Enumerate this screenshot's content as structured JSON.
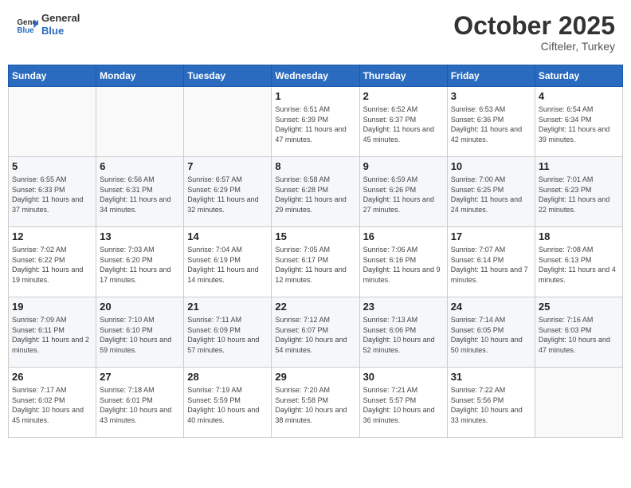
{
  "header": {
    "logo_line1": "General",
    "logo_line2": "Blue",
    "month": "October 2025",
    "location": "Cifteler, Turkey"
  },
  "weekdays": [
    "Sunday",
    "Monday",
    "Tuesday",
    "Wednesday",
    "Thursday",
    "Friday",
    "Saturday"
  ],
  "weeks": [
    [
      {
        "day": null
      },
      {
        "day": null
      },
      {
        "day": null
      },
      {
        "day": 1,
        "sunrise": "6:51 AM",
        "sunset": "6:39 PM",
        "daylight": "11 hours and 47 minutes."
      },
      {
        "day": 2,
        "sunrise": "6:52 AM",
        "sunset": "6:37 PM",
        "daylight": "11 hours and 45 minutes."
      },
      {
        "day": 3,
        "sunrise": "6:53 AM",
        "sunset": "6:36 PM",
        "daylight": "11 hours and 42 minutes."
      },
      {
        "day": 4,
        "sunrise": "6:54 AM",
        "sunset": "6:34 PM",
        "daylight": "11 hours and 39 minutes."
      }
    ],
    [
      {
        "day": 5,
        "sunrise": "6:55 AM",
        "sunset": "6:33 PM",
        "daylight": "11 hours and 37 minutes."
      },
      {
        "day": 6,
        "sunrise": "6:56 AM",
        "sunset": "6:31 PM",
        "daylight": "11 hours and 34 minutes."
      },
      {
        "day": 7,
        "sunrise": "6:57 AM",
        "sunset": "6:29 PM",
        "daylight": "11 hours and 32 minutes."
      },
      {
        "day": 8,
        "sunrise": "6:58 AM",
        "sunset": "6:28 PM",
        "daylight": "11 hours and 29 minutes."
      },
      {
        "day": 9,
        "sunrise": "6:59 AM",
        "sunset": "6:26 PM",
        "daylight": "11 hours and 27 minutes."
      },
      {
        "day": 10,
        "sunrise": "7:00 AM",
        "sunset": "6:25 PM",
        "daylight": "11 hours and 24 minutes."
      },
      {
        "day": 11,
        "sunrise": "7:01 AM",
        "sunset": "6:23 PM",
        "daylight": "11 hours and 22 minutes."
      }
    ],
    [
      {
        "day": 12,
        "sunrise": "7:02 AM",
        "sunset": "6:22 PM",
        "daylight": "11 hours and 19 minutes."
      },
      {
        "day": 13,
        "sunrise": "7:03 AM",
        "sunset": "6:20 PM",
        "daylight": "11 hours and 17 minutes."
      },
      {
        "day": 14,
        "sunrise": "7:04 AM",
        "sunset": "6:19 PM",
        "daylight": "11 hours and 14 minutes."
      },
      {
        "day": 15,
        "sunrise": "7:05 AM",
        "sunset": "6:17 PM",
        "daylight": "11 hours and 12 minutes."
      },
      {
        "day": 16,
        "sunrise": "7:06 AM",
        "sunset": "6:16 PM",
        "daylight": "11 hours and 9 minutes."
      },
      {
        "day": 17,
        "sunrise": "7:07 AM",
        "sunset": "6:14 PM",
        "daylight": "11 hours and 7 minutes."
      },
      {
        "day": 18,
        "sunrise": "7:08 AM",
        "sunset": "6:13 PM",
        "daylight": "11 hours and 4 minutes."
      }
    ],
    [
      {
        "day": 19,
        "sunrise": "7:09 AM",
        "sunset": "6:11 PM",
        "daylight": "11 hours and 2 minutes."
      },
      {
        "day": 20,
        "sunrise": "7:10 AM",
        "sunset": "6:10 PM",
        "daylight": "10 hours and 59 minutes."
      },
      {
        "day": 21,
        "sunrise": "7:11 AM",
        "sunset": "6:09 PM",
        "daylight": "10 hours and 57 minutes."
      },
      {
        "day": 22,
        "sunrise": "7:12 AM",
        "sunset": "6:07 PM",
        "daylight": "10 hours and 54 minutes."
      },
      {
        "day": 23,
        "sunrise": "7:13 AM",
        "sunset": "6:06 PM",
        "daylight": "10 hours and 52 minutes."
      },
      {
        "day": 24,
        "sunrise": "7:14 AM",
        "sunset": "6:05 PM",
        "daylight": "10 hours and 50 minutes."
      },
      {
        "day": 25,
        "sunrise": "7:16 AM",
        "sunset": "6:03 PM",
        "daylight": "10 hours and 47 minutes."
      }
    ],
    [
      {
        "day": 26,
        "sunrise": "7:17 AM",
        "sunset": "6:02 PM",
        "daylight": "10 hours and 45 minutes."
      },
      {
        "day": 27,
        "sunrise": "7:18 AM",
        "sunset": "6:01 PM",
        "daylight": "10 hours and 43 minutes."
      },
      {
        "day": 28,
        "sunrise": "7:19 AM",
        "sunset": "5:59 PM",
        "daylight": "10 hours and 40 minutes."
      },
      {
        "day": 29,
        "sunrise": "7:20 AM",
        "sunset": "5:58 PM",
        "daylight": "10 hours and 38 minutes."
      },
      {
        "day": 30,
        "sunrise": "7:21 AM",
        "sunset": "5:57 PM",
        "daylight": "10 hours and 36 minutes."
      },
      {
        "day": 31,
        "sunrise": "7:22 AM",
        "sunset": "5:56 PM",
        "daylight": "10 hours and 33 minutes."
      },
      {
        "day": null
      }
    ]
  ],
  "labels": {
    "sunrise_prefix": "Sunrise: ",
    "sunset_prefix": "Sunset: ",
    "daylight_prefix": "Daylight: "
  }
}
